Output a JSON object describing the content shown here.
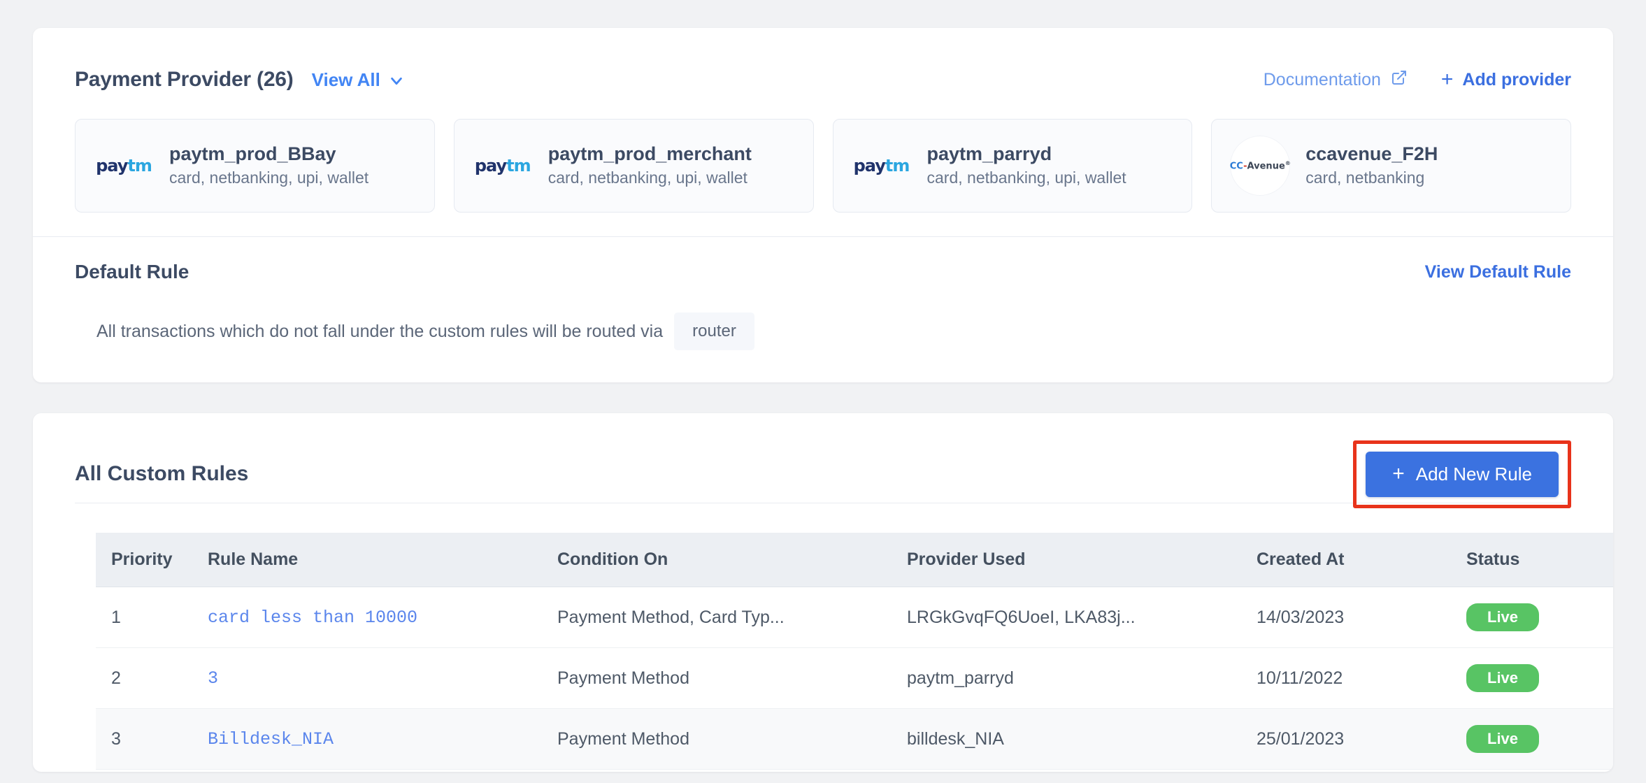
{
  "providers_section": {
    "title": "Payment Provider (26)",
    "view_all_label": "View All",
    "chevron_icon": "chevron-down-icon",
    "documentation_label": "Documentation",
    "documentation_icon": "external-link-icon",
    "add_provider_label": "Add provider",
    "plus_icon": "+",
    "cards": [
      {
        "logo": "paytm-logo",
        "logo_part1": "pay",
        "logo_part2": "tm",
        "name": "paytm_prod_BBay",
        "methods": "card, netbanking, upi, wallet"
      },
      {
        "logo": "paytm-logo",
        "logo_part1": "pay",
        "logo_part2": "tm",
        "name": "paytm_prod_merchant",
        "methods": "card, netbanking, upi, wallet"
      },
      {
        "logo": "paytm-logo",
        "logo_part1": "pay",
        "logo_part2": "tm",
        "name": "paytm_parryd",
        "methods": "card, netbanking, upi, wallet"
      },
      {
        "logo": "ccavenue-logo",
        "logo_part1": "CC",
        "logo_part2": "Avenue",
        "name": "ccavenue_F2H",
        "methods": "card, netbanking"
      }
    ]
  },
  "default_rule": {
    "title": "Default Rule",
    "view_link_label": "View Default Rule",
    "description": "All transactions which do not fall under the custom rules will be routed via",
    "router_chip": "router"
  },
  "custom_rules": {
    "title": "All Custom Rules",
    "add_rule_label": "Add New Rule",
    "plus_icon": "+",
    "columns": [
      "Priority",
      "Rule Name",
      "Condition On",
      "Provider Used",
      "Created At",
      "Status"
    ],
    "rows": [
      {
        "priority": "1",
        "rule_name": "card less than 10000",
        "condition_on": "Payment Method, Card Typ...",
        "provider_used": "LRGkGvqFQ6UoeI, LKA83j...",
        "created_at": "14/03/2023",
        "status": "Live"
      },
      {
        "priority": "2",
        "rule_name": "3",
        "condition_on": "Payment Method",
        "provider_used": "paytm_parryd",
        "created_at": "10/11/2022",
        "status": "Live"
      },
      {
        "priority": "3",
        "rule_name": "Billdesk_NIA",
        "condition_on": "Payment Method",
        "provider_used": "billdesk_NIA",
        "created_at": "25/01/2023",
        "status": "Live"
      }
    ]
  },
  "colors": {
    "page_background": "#f1f2f4",
    "heading": "#3c4a63",
    "link_blue": "#3b6fe0",
    "light_link_blue": "#6e9beb",
    "primary_button": "#3b72e0",
    "highlight_box": "#e8331b",
    "status_live": "#58c464",
    "rule_name_blue": "#5b86ec"
  }
}
